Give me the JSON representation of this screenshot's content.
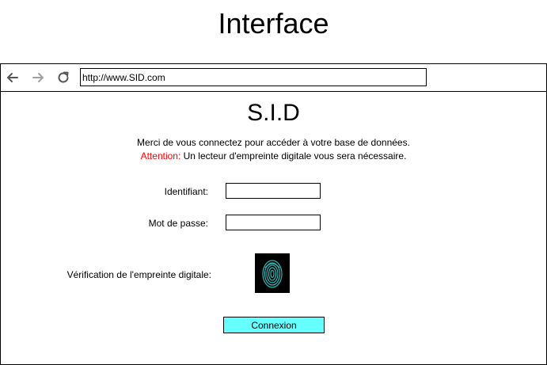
{
  "page": {
    "title": "Interface"
  },
  "browser": {
    "url": "http://www.SID.com",
    "back_icon": "arrow-left-icon",
    "forward_icon": "arrow-right-icon",
    "reload_icon": "reload-icon"
  },
  "site": {
    "title": "S.I.D",
    "message_line1": "Merci de vous connectez pour accéder à votre base de données.",
    "attention_label": "Attention:",
    "message_line2": " Un lecteur d'empreinte digitale vous sera nécessaire."
  },
  "form": {
    "identifier_label": "Identifiant:",
    "identifier_value": "",
    "password_label": "Mot de passe:",
    "password_value": "",
    "fingerprint_label": "Vérification de l'empreinte digitale:",
    "fingerprint_icon": "fingerprint-icon",
    "submit_label": "Connexion"
  },
  "colors": {
    "attention": "#ff0000",
    "button_bg": "#66ffff",
    "fingerprint_bg": "#000000",
    "fingerprint_ridges": "#33cccc",
    "forward_disabled": "#a0a0a0"
  }
}
